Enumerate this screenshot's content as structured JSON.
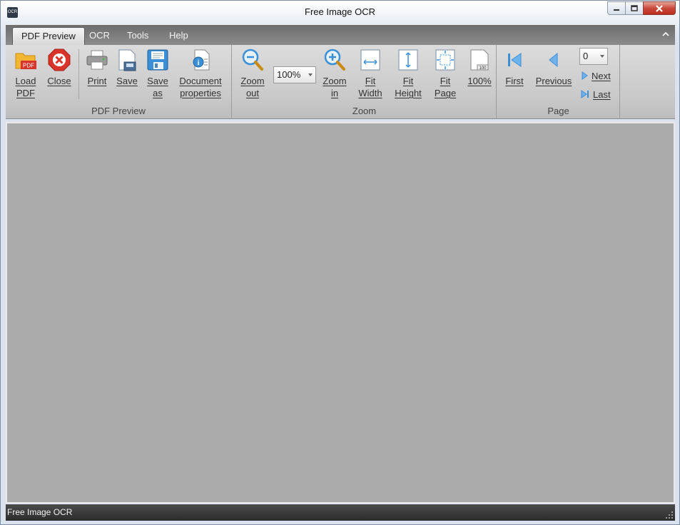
{
  "window": {
    "title": "Free Image OCR",
    "app_icon_text": "OCR"
  },
  "tabs": [
    {
      "label": "PDF Preview",
      "active": true
    },
    {
      "label": "OCR",
      "active": false
    },
    {
      "label": "Tools",
      "active": false
    },
    {
      "label": "Help",
      "active": false
    }
  ],
  "ribbon": {
    "pdf_preview": {
      "group_label": "PDF Preview",
      "load_pdf": "Load\nPDF",
      "load_pdf_badge": "PDF",
      "close": "Close",
      "print": "Print",
      "save": "Save",
      "save_as": "Save\nas",
      "document_properties": "Document\nproperties"
    },
    "zoom": {
      "group_label": "Zoom",
      "zoom_out": "Zoom\nout",
      "zoom_value": "100%",
      "zoom_in": "Zoom\nin",
      "fit_width": "Fit\nWidth",
      "fit_height": "Fit\nHeight",
      "fit_page": "Fit\nPage",
      "actual_size": "100%",
      "actual_size_badge": "100"
    },
    "page": {
      "group_label": "Page",
      "first": "First",
      "previous": "Previous",
      "page_value": "0",
      "next": "Next",
      "last": "Last"
    }
  },
  "status": {
    "text": "Free Image OCR"
  },
  "colors": {
    "accent_blue": "#3a8fd6",
    "close_red": "#d9342b",
    "folder_yellow": "#f2b632"
  }
}
